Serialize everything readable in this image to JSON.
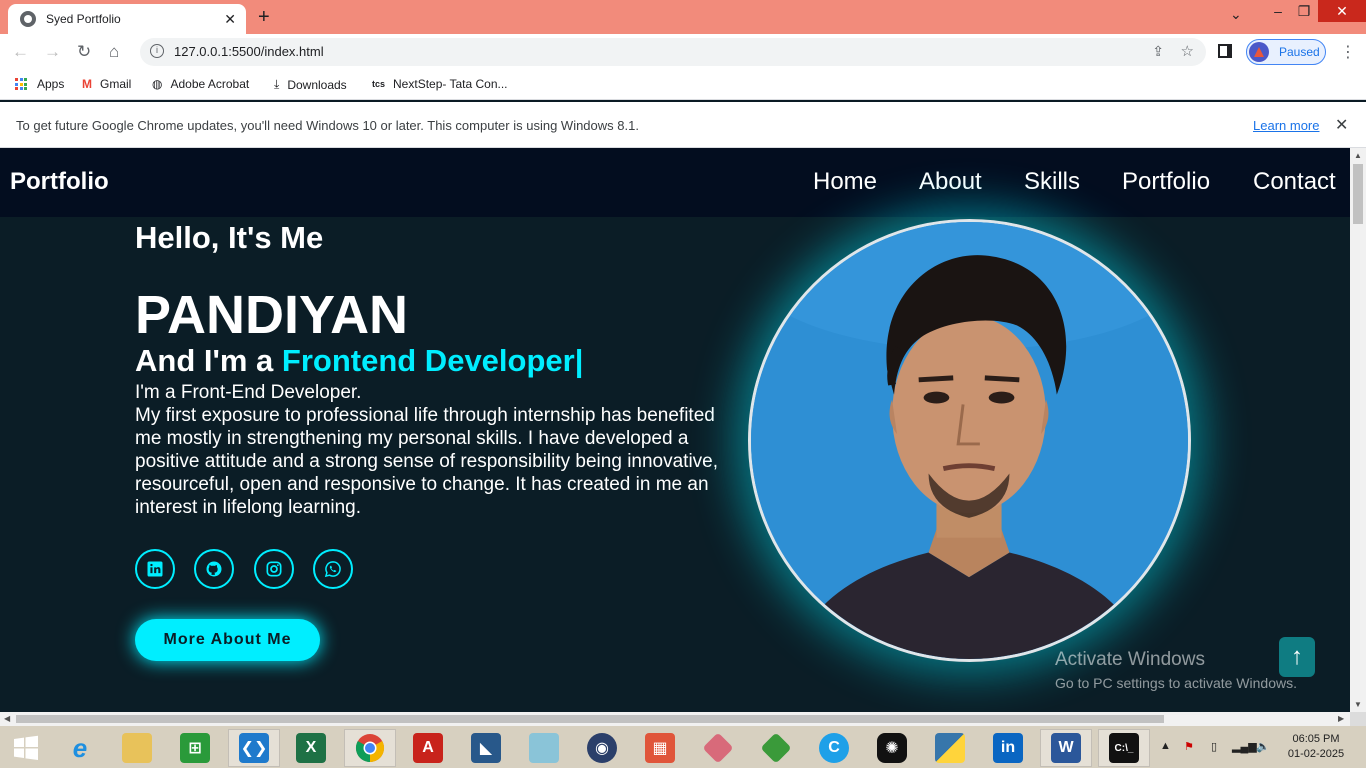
{
  "browser": {
    "tab_title": "Syed Portfolio",
    "tab_close": "✕",
    "new_tab": "+",
    "url": "127.0.0.1:5500/index.html",
    "profile_status": "Paused",
    "bookmarks": [
      "Apps",
      "Gmail",
      "Adobe Acrobat",
      "Downloads",
      "NextStep- Tata Con..."
    ],
    "infobar_message": "To get future Google Chrome updates, you'll need Windows 10 or later. This computer is using Windows 8.1.",
    "infobar_link": "Learn more"
  },
  "site": {
    "logo": "Portfolio",
    "nav": [
      "Home",
      "About",
      "Skills",
      "Portfolio",
      "Contact"
    ],
    "hello": "Hello, It's Me",
    "name": "PANDIYAN",
    "role_prefix": "And I'm a ",
    "role_accent": "Frontend Developer|",
    "bio_line1": "I'm a Front-End Developer.",
    "bio_body": "My first exposure to professional life through internship has benefited me mostly in strengthening my personal skills. I have developed a positive attitude and a strong sense of responsibility being innovative, resourceful, open and responsive to change. It has created in me an interest in lifelong learning.",
    "socials": [
      "linkedin-icon",
      "github-icon",
      "instagram-icon",
      "whatsapp-icon"
    ],
    "cta": "More About Me",
    "accent_color": "#00eeff",
    "back_to_top": "↑"
  },
  "watermark": {
    "line1": "Activate Windows",
    "line2": "Go to PC settings to activate Windows."
  },
  "taskbar": {
    "time": "06:05 PM",
    "date": "01-02-2025",
    "apps": [
      "windows-start-icon",
      "internet-explorer-icon",
      "file-explorer-icon",
      "store-icon",
      "vscode-icon",
      "excel-icon",
      "chrome-icon",
      "acrobat-icon",
      "mysql-icon",
      "app-icon",
      "media-icon",
      "app-icon-2",
      "app-icon-3",
      "app-icon-4",
      "app-icon-5",
      "chatgpt-icon",
      "python-icon",
      "linkedin-icon",
      "word-icon",
      "cmd-icon"
    ]
  }
}
